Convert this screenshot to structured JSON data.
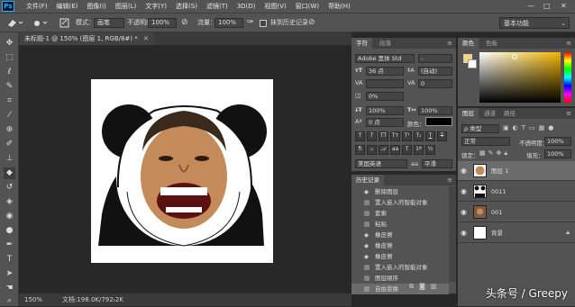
{
  "app": {
    "logo": "Ps"
  },
  "menu": [
    "文件(F)",
    "编辑(E)",
    "图像(I)",
    "图层(L)",
    "文字(Y)",
    "选择(S)",
    "滤镜(T)",
    "3D(D)",
    "视图(V)",
    "窗口(W)",
    "帮助(H)"
  ],
  "window_controls": {
    "minimize": "—",
    "maximize": "□",
    "close": "✕"
  },
  "options": {
    "mode_label": "模式：",
    "mode_value": "画笔",
    "opacity_label": "不透明度：",
    "opacity_value": "100%",
    "flow_label": "流量：",
    "flow_value": "100%",
    "history_label": "抹到历史记录"
  },
  "workspace": "基本功能",
  "document": {
    "tab": "未标题-1 @ 150% (图层 1, RGB/8#) *",
    "zoom": "150%",
    "doc_info": "文档:198.0K/792.2K"
  },
  "character_panel": {
    "tabs": [
      "字符",
      "段落"
    ],
    "font_family": "Adobe 黑体 Std",
    "font_style": "-",
    "size": "36 点",
    "leading": "(自动)",
    "kerning": "",
    "tracking": "0",
    "scale": "0%",
    "vscale": "100%",
    "hscale": "100%",
    "baseline": "0 点",
    "color_label": "颜色：",
    "language": "美国英语",
    "aa": "平滑",
    "aa_prefix": "aa"
  },
  "history_panel": {
    "title": "历史记录",
    "items": [
      {
        "icon": "eraser-icon",
        "label": "删除图层"
      },
      {
        "icon": "layer-icon",
        "label": "置入嵌入的智能对象"
      },
      {
        "icon": "layer-icon",
        "label": "套索"
      },
      {
        "icon": "layer-icon",
        "label": "粘贴"
      },
      {
        "icon": "eraser-icon",
        "label": "橡皮擦"
      },
      {
        "icon": "eraser-icon",
        "label": "橡皮擦"
      },
      {
        "icon": "eraser-icon",
        "label": "橡皮擦"
      },
      {
        "icon": "layer-icon",
        "label": "置入嵌入的智能对象"
      },
      {
        "icon": "layer-icon",
        "label": "图层顺序"
      },
      {
        "icon": "layer-icon",
        "label": "自由变换"
      }
    ]
  },
  "color_panel": {
    "tabs": [
      "颜色",
      "色板"
    ]
  },
  "layers_panel": {
    "tabs": [
      "图层",
      "通道",
      "路径"
    ],
    "filter": "ρ 类型",
    "blend": "正常",
    "opacity_label": "不透明度：",
    "opacity_value": "100%",
    "lock_label": "锁定：",
    "fill_label": "填充：",
    "fill_value": "100%",
    "layers": [
      {
        "name": "图层 1",
        "selected": true
      },
      {
        "name": "0011",
        "selected": false
      },
      {
        "name": "001",
        "selected": false
      },
      {
        "name": "背景",
        "selected": false
      }
    ]
  },
  "watermark": "头条号 / Greepy",
  "colors": {
    "accent": "#31a8ff",
    "panel": "#535353",
    "dark": "#282828",
    "foreground": "#f7d774"
  }
}
